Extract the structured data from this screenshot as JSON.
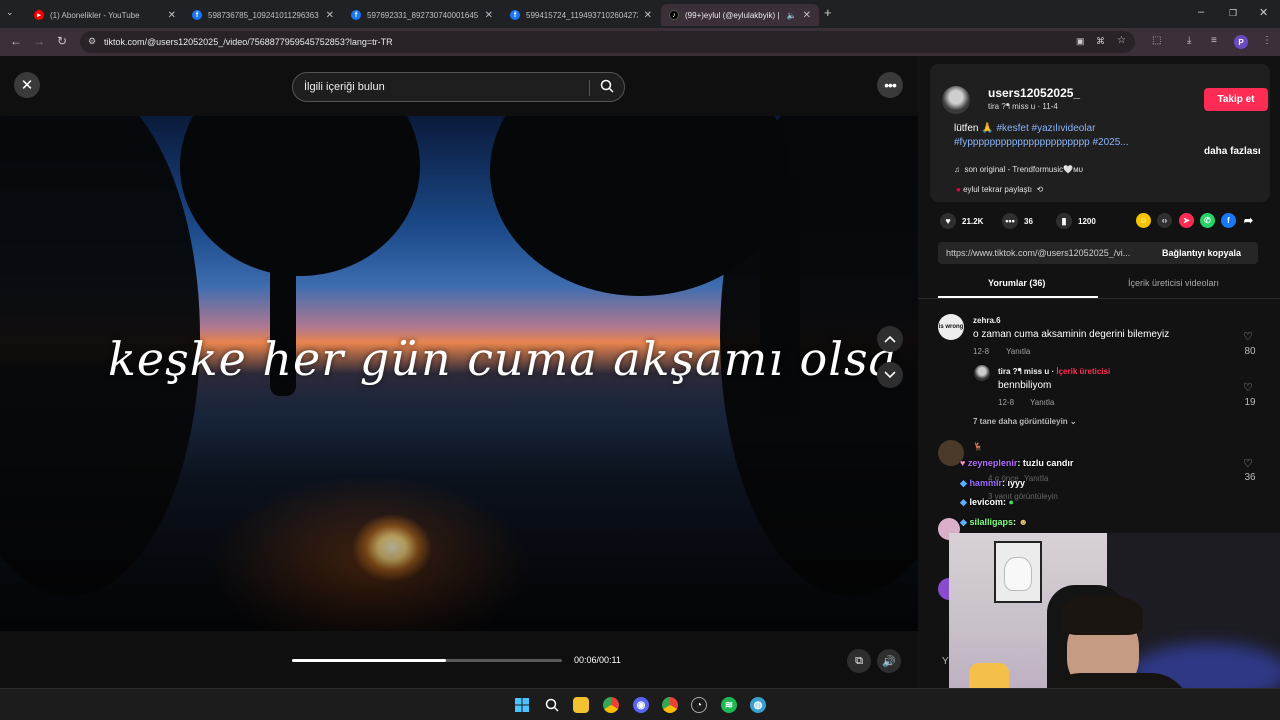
{
  "browser": {
    "tabs": [
      {
        "title": "(1) Abonelikler - YouTube",
        "icon": "youtube-icon",
        "color": "#ff0000",
        "active": false
      },
      {
        "title": "598736785_109241011296363",
        "icon": "facebook-icon",
        "color": "#1877f2",
        "active": false
      },
      {
        "title": "597692331_892730740001645",
        "icon": "facebook-icon",
        "color": "#1877f2",
        "active": false
      },
      {
        "title": "599415724_1194937102604273",
        "icon": "facebook-icon",
        "color": "#1877f2",
        "active": false
      },
      {
        "title": "(99+)eylul (@eylulakbyik) |",
        "icon": "tiktok-icon",
        "color": "#000000",
        "active": true
      }
    ],
    "url": "tiktok.com/@users12052025_/video/7568877959545752853?lang=tr-TR"
  },
  "video": {
    "search_placeholder": "İlgili içeriği bulun",
    "overlay_text": "keşke her gün cuma akşamı olsa",
    "time": "00:06/00:11",
    "progress": 0.57
  },
  "author": {
    "username": "users12052025_",
    "subline": "tira ?ᖳ miss u · 11-4",
    "follow_label": "Takip et",
    "desc_line1_plain": "lütfen 🙏 ",
    "desc_line1_tags": "#kesfet #yazılıvideolar",
    "desc_line2_tags": "#fypppppppppppppppppppppp #2025...",
    "more_label": "daha fazlası",
    "music": "son original - Trendformusic🤍ᴍᴜ",
    "repost": "eylul tekrar paylaştı"
  },
  "stats": {
    "likes": "21.2K",
    "comments": "36",
    "saves": "1200"
  },
  "share": {
    "url": "https://www.tiktok.com/@users12052025_/vi...",
    "copy_label": "Bağlantıyı kopyala"
  },
  "panel_tabs": {
    "comments": "Yorumlar (36)",
    "creator_videos": "İçerik üreticisi videoları"
  },
  "comments": [
    {
      "name": "zehra.6",
      "text": "o zaman cuma aksaminin degerini bilemeyiz",
      "date": "12-8",
      "reply_label": "Yanıtla",
      "likes": "80"
    }
  ],
  "reply": {
    "name": "tira ?ᖳ miss u",
    "badge": "İçerik üreticisi",
    "text": "bennbiliyom",
    "date": "12-8",
    "reply_label": "Yanıtla",
    "likes": "19"
  },
  "more_replies": "7 tane daha görüntüleyin",
  "comment2": {
    "name": "zeynepleniiir",
    "likes": "36",
    "time": "4 g önce",
    "reply_label": "Yanıtla",
    "more": "3 yanıt görüntüleyin"
  },
  "stream_chat": [
    {
      "user": "zeyneplenir",
      "msg": ": tuzlu candır",
      "color": "#b46cff"
    },
    {
      "user": "hammir",
      "msg": ": ıyyy",
      "color": "#9b6cff"
    },
    {
      "user": "levicom",
      "msg": ":",
      "color": "#ffffff"
    },
    {
      "user": "silalligaps",
      "msg": ":",
      "color": "#7fff7f"
    }
  ]
}
